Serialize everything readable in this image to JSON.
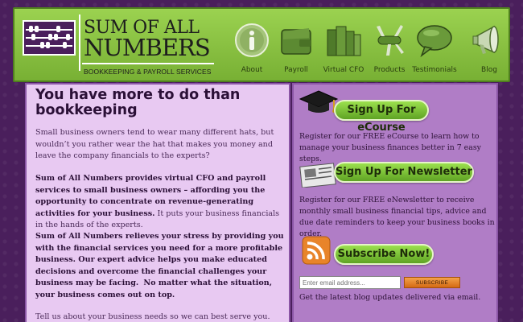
{
  "header": {
    "logo": {
      "line1": "SUM OF ALL",
      "line2": "NUMBERS",
      "tagline": "BOOKKEEPING & PAYROLL SERVICES"
    },
    "nav": [
      {
        "label": "About",
        "icon": "info-icon"
      },
      {
        "label": "Payroll",
        "icon": "wallet-icon"
      },
      {
        "label": "Virtual CFO",
        "icon": "books-icon"
      },
      {
        "label": "Products",
        "icon": "swiss-knife-icon"
      },
      {
        "label": "Testimonials",
        "icon": "speech-bubble-icon"
      },
      {
        "label": "Blog",
        "icon": "megaphone-icon"
      }
    ]
  },
  "main": {
    "title": "You have more to do than bookkeeping",
    "para1": "Small business owners tend to wear many different hats, but wouldn’t you rather wear the hat that makes you money and leave the company financials to the experts?",
    "para2_bold": "Sum of All Numbers provides virtual CFO and payroll services to small business owners – affording you the opportunity to concentrate on revenue-generating activities for your business.",
    "para2_rest": " It puts your business financials in the hands of the experts.",
    "para3_bold": "Sum of All Numbers relieves your stress by providing you with the financial services you need for a more profitable business. Our expert advice helps you make educated decisions and overcome the financial challenges your business may be facing.",
    "para3_bold2": "No matter what the situation, your business comes out on top.",
    "para4": "Tell us about your business needs so we can best serve you.  Complete"
  },
  "sidebar": {
    "ecourse_button": "Sign Up For eCourse",
    "ecourse_text": "Register for our FREE eCourse to learn how to manage your business finances better in 7 easy steps.",
    "newsletter_button": "Sign Up For Newsletter",
    "newsletter_text": "Register for our FREE eNewsletter to receive monthly small business financial tips, advice and due date reminders to keep your business books in order.",
    "subscribe_button": "Subscribe Now!",
    "email_placeholder": "Enter email address...",
    "subscribe_small": "SUBSCRIBE",
    "blog_text": "Get the latest blog updates delivered via email."
  },
  "colors": {
    "header_green": "#8bc34a",
    "purple_dark": "#4a1f5c",
    "main_bg": "#e8c9f2",
    "sidebar_bg": "#b07dc6"
  }
}
